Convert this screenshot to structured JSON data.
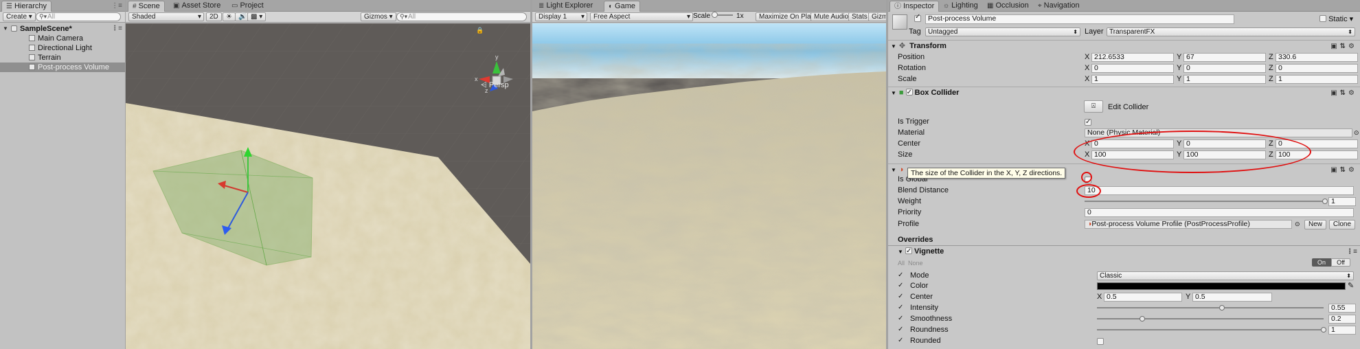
{
  "hierarchy": {
    "tab_label": "Hierarchy",
    "create_label": "Create",
    "search_placeholder": "All",
    "scene_name": "SampleScene*",
    "items": [
      {
        "label": "Main Camera"
      },
      {
        "label": "Directional Light"
      },
      {
        "label": "Terrain"
      },
      {
        "label": "Post-process Volume"
      }
    ]
  },
  "scene_view": {
    "tabs": [
      {
        "label": "Scene"
      },
      {
        "label": "Asset Store"
      },
      {
        "label": "Project"
      }
    ],
    "shading_mode": "Shaded",
    "mode_2d": "2D",
    "gizmos_label": "Gizmos",
    "search_placeholder": "All",
    "persp_label": "Persp",
    "gizmo_axes": {
      "x": "x",
      "y": "y",
      "z": "z"
    }
  },
  "game_view": {
    "tabs": [
      {
        "label": "Light Explorer"
      },
      {
        "label": "Game"
      }
    ],
    "display": "Display 1",
    "aspect": "Free Aspect",
    "scale_label": "Scale",
    "scale_value": "1x",
    "maximize_label": "Maximize On Play",
    "mute_label": "Mute Audio",
    "stats_label": "Stats",
    "gizmos_label": "Gizm"
  },
  "inspector": {
    "tabs": [
      {
        "label": "Inspector"
      },
      {
        "label": "Lighting"
      },
      {
        "label": "Occlusion"
      },
      {
        "label": "Navigation"
      }
    ],
    "object_name": "Post-process Volume",
    "static_label": "Static",
    "tag_label": "Tag",
    "tag_value": "Untagged",
    "layer_label": "Layer",
    "layer_value": "TransparentFX",
    "transform": {
      "title": "Transform",
      "position_label": "Position",
      "rotation_label": "Rotation",
      "scale_label": "Scale",
      "position": {
        "x": "212.6533",
        "y": "67",
        "z": "330.6"
      },
      "rotation": {
        "x": "0",
        "y": "0",
        "z": "0"
      },
      "scale": {
        "x": "1",
        "y": "1",
        "z": "1"
      }
    },
    "box_collider": {
      "title": "Box Collider",
      "edit_collider_label": "Edit Collider",
      "is_trigger_label": "Is Trigger",
      "material_label": "Material",
      "material_value": "None (Physic Material)",
      "center_label": "Center",
      "center": {
        "x": "0",
        "y": "0",
        "z": "0"
      },
      "size_label": "Size",
      "size": {
        "x": "100",
        "y": "100",
        "z": "100"
      }
    },
    "tooltip": "The size of the Collider in the X, Y, Z directions.",
    "post_volume": {
      "is_global_label": "Is Global",
      "blend_distance_label": "Blend Distance",
      "blend_distance_value": "10",
      "weight_label": "Weight",
      "weight_value": "1",
      "weight_fraction": 1.0,
      "priority_label": "Priority",
      "priority_value": "0",
      "profile_label": "Profile",
      "profile_value": "Post-process Volume Profile (PostProcessProfile)",
      "new_label": "New",
      "clone_label": "Clone",
      "overrides_label": "Overrides"
    },
    "vignette": {
      "title": "Vignette",
      "all_label": "All",
      "none_label": "None",
      "on_label": "On",
      "off_label": "Off",
      "mode_label": "Mode",
      "mode_value": "Classic",
      "color_label": "Color",
      "center_label": "Center",
      "center": {
        "x": "0.5",
        "y": "0.5"
      },
      "intensity_label": "Intensity",
      "intensity_value": "0.55",
      "intensity_fraction": 0.55,
      "smoothness_label": "Smoothness",
      "smoothness_value": "0.2",
      "smoothness_fraction": 0.2,
      "roundness_label": "Roundness",
      "roundness_value": "1",
      "roundness_fraction": 1.0,
      "rounded_label": "Rounded"
    }
  },
  "colors": {
    "annotation": "#e01010",
    "terrain": "#d9cfad",
    "sky": "#9fd3ee"
  }
}
